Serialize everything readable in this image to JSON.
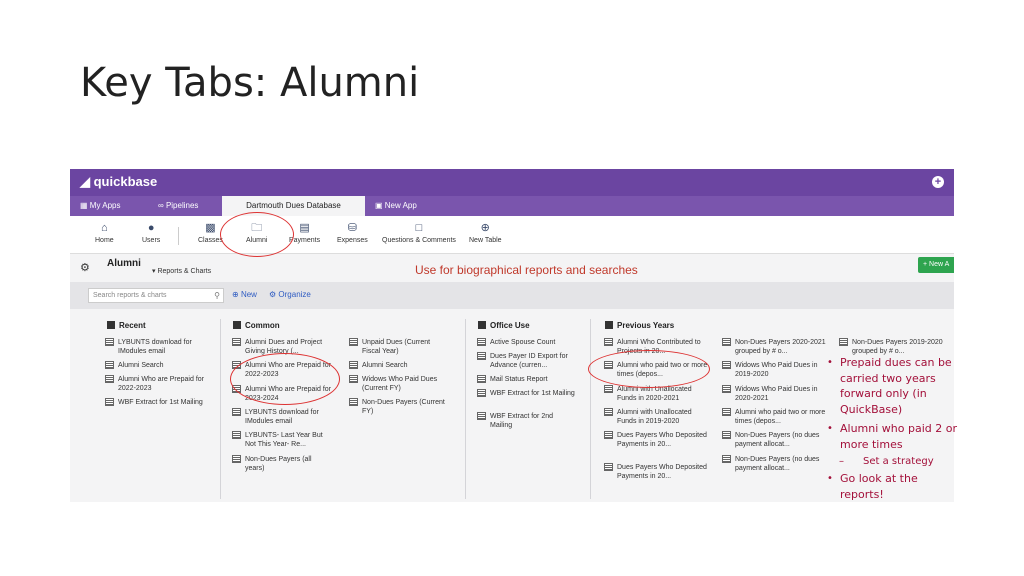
{
  "slide": {
    "title": "Key Tabs:  Alumni"
  },
  "app": {
    "logo": "quickbase",
    "tabs": {
      "my_apps": "My Apps",
      "pipelines": "Pipelines",
      "database": "Dartmouth Dues Database",
      "new_app": "New App"
    },
    "nav": {
      "home": "Home",
      "users": "Users",
      "classes": "Classes",
      "alumni": "Alumni",
      "payments": "Payments",
      "expenses": "Expenses",
      "questions": "Questions & Comments",
      "new_table": "New Table"
    },
    "table": {
      "title": "Alumni",
      "subtitle": "Reports & Charts",
      "new_button": "+ New A"
    },
    "search": {
      "placeholder": "Search reports & charts",
      "new": "New",
      "organize": "Organize"
    }
  },
  "annotation": "Use for biographical reports and searches",
  "sections": {
    "recent": {
      "heading": "Recent",
      "items": [
        "LYBUNTS download for IModules email",
        "Alumni Search",
        "Alumni Who are Prepaid for 2022-2023",
        "WBF Extract for 1st Mailing"
      ]
    },
    "common": {
      "heading": "Common",
      "col1": [
        "Alumni Dues and Project Giving History (...",
        "Alumni Who are Prepaid for 2022-2023",
        "Alumni Who are Prepaid for 2023-2024",
        "LYBUNTS download for IModules email",
        "LYBUNTS- Last Year But Not This Year- Re...",
        "Non-Dues Payers (all years)"
      ],
      "col2": [
        "Unpaid Dues (Current Fiscal Year)",
        "Alumni Search",
        "Widows Who Paid Dues (Current FY)",
        "Non-Dues Payers (Current FY)"
      ]
    },
    "office": {
      "heading": "Office Use",
      "items": [
        "Active Spouse Count",
        "Dues Payer ID Export for Advance (curren...",
        "Mail Status Report",
        "WBF Extract for 1st Mailing",
        "WBF Extract for 2nd Mailing"
      ]
    },
    "previous": {
      "heading": "Previous Years",
      "col1": [
        "Alumni Who Contributed to Projects in 20...",
        "Alumni who paid two or more times (depos...",
        "Alumni with Unallocated Funds in 2020-2021",
        "Alumni with Unallocated Funds in 2019-2020",
        "Dues Payers Who Deposited Payments in 20...",
        "Dues Payers Who Deposited Payments in 20..."
      ],
      "col2": [
        "Non-Dues Payers 2020-2021 grouped by # o...",
        "Widows Who Paid Dues in 2019-2020",
        "Widows Who Paid Dues in 2020-2021",
        "Alumni who paid two or more times (depos...",
        "Non-Dues Payers (no dues payment allocat...",
        "Non-Dues Payers (no dues payment allocat..."
      ],
      "col3": [
        "Non-Dues Payers 2019-2020 grouped by # o..."
      ]
    }
  },
  "notes": {
    "b1": [
      "Prepaid dues can be",
      "carried two years",
      "forward only (in",
      "QuickBase)"
    ],
    "b2": [
      "Alumni who paid 2 or",
      "more times"
    ],
    "sub": "Set a strategy",
    "b3": [
      "Go look at the",
      "reports!"
    ]
  },
  "colors": {
    "brand": "#6b45a1",
    "annotation": "#c0392b",
    "note": "#a3103a",
    "new_button": "#2ea44f"
  }
}
